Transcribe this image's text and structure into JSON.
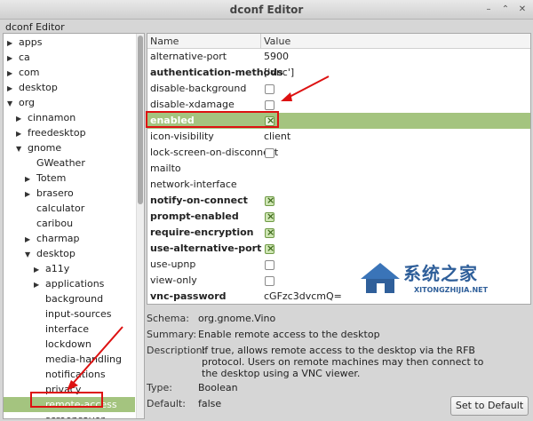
{
  "window": {
    "title": "dconf Editor",
    "app_name": "dconf Editor"
  },
  "tree": {
    "items": [
      {
        "label": "apps",
        "indent": 0,
        "arrow": "right"
      },
      {
        "label": "ca",
        "indent": 0,
        "arrow": "right"
      },
      {
        "label": "com",
        "indent": 0,
        "arrow": "right"
      },
      {
        "label": "desktop",
        "indent": 0,
        "arrow": "right"
      },
      {
        "label": "org",
        "indent": 0,
        "arrow": "down"
      },
      {
        "label": "cinnamon",
        "indent": 1,
        "arrow": "right"
      },
      {
        "label": "freedesktop",
        "indent": 1,
        "arrow": "right"
      },
      {
        "label": "gnome",
        "indent": 1,
        "arrow": "down"
      },
      {
        "label": "GWeather",
        "indent": 2,
        "arrow": ""
      },
      {
        "label": "Totem",
        "indent": 2,
        "arrow": "right"
      },
      {
        "label": "brasero",
        "indent": 2,
        "arrow": "right"
      },
      {
        "label": "calculator",
        "indent": 2,
        "arrow": ""
      },
      {
        "label": "caribou",
        "indent": 2,
        "arrow": ""
      },
      {
        "label": "charmap",
        "indent": 2,
        "arrow": "right"
      },
      {
        "label": "desktop",
        "indent": 2,
        "arrow": "down"
      },
      {
        "label": "a11y",
        "indent": 3,
        "arrow": "right"
      },
      {
        "label": "applications",
        "indent": 3,
        "arrow": "right"
      },
      {
        "label": "background",
        "indent": 3,
        "arrow": ""
      },
      {
        "label": "input-sources",
        "indent": 3,
        "arrow": ""
      },
      {
        "label": "interface",
        "indent": 3,
        "arrow": ""
      },
      {
        "label": "lockdown",
        "indent": 3,
        "arrow": ""
      },
      {
        "label": "media-handling",
        "indent": 3,
        "arrow": ""
      },
      {
        "label": "notifications",
        "indent": 3,
        "arrow": ""
      },
      {
        "label": "privacy",
        "indent": 3,
        "arrow": ""
      },
      {
        "label": "remote-access",
        "indent": 3,
        "arrow": "",
        "selected": true
      },
      {
        "label": "screensaver",
        "indent": 3,
        "arrow": ""
      }
    ]
  },
  "list": {
    "col_name": "Name",
    "col_value": "Value",
    "rows": [
      {
        "name": "alternative-port",
        "value": "5900",
        "bold": false
      },
      {
        "name": "authentication-methods",
        "value": "['vnc']",
        "bold": true
      },
      {
        "name": "disable-background",
        "check": "off",
        "bold": false
      },
      {
        "name": "disable-xdamage",
        "check": "off",
        "bold": false
      },
      {
        "name": "enabled",
        "check": "on",
        "bold": true,
        "selected": true
      },
      {
        "name": "icon-visibility",
        "value": "client",
        "bold": false
      },
      {
        "name": "lock-screen-on-disconnect",
        "check": "off",
        "bold": false
      },
      {
        "name": "mailto",
        "value": "",
        "bold": false
      },
      {
        "name": "network-interface",
        "value": "",
        "bold": false
      },
      {
        "name": "notify-on-connect",
        "check": "on",
        "bold": true
      },
      {
        "name": "prompt-enabled",
        "check": "on",
        "bold": true
      },
      {
        "name": "require-encryption",
        "check": "on",
        "bold": true
      },
      {
        "name": "use-alternative-port",
        "check": "on",
        "bold": true
      },
      {
        "name": "use-upnp",
        "check": "off",
        "bold": false
      },
      {
        "name": "view-only",
        "check": "off",
        "bold": false
      },
      {
        "name": "vnc-password",
        "value": "cGFzc3dvcmQ=",
        "bold": true
      }
    ]
  },
  "details": {
    "schema_label": "Schema:",
    "schema_value": "org.gnome.Vino",
    "summary_label": "Summary:",
    "summary_value": "Enable remote access to the desktop",
    "description_label": "Description:",
    "description_value": "If true, allows remote access to the desktop via the RFB protocol. Users on remote machines may then connect to the desktop using a VNC viewer.",
    "type_label": "Type:",
    "type_value": "Boolean",
    "default_label": "Default:",
    "default_value": "false",
    "set_default_label": "Set to Default"
  },
  "watermark": {
    "text": "系统之家",
    "url": "XITONGZHIJIA.NET"
  },
  "colors": {
    "selection": "#a4c47f",
    "annotation": "#dd1111"
  },
  "icons": [
    "expander-right-icon",
    "expander-down-icon",
    "close-icon",
    "maximize-icon",
    "minimize-icon"
  ]
}
